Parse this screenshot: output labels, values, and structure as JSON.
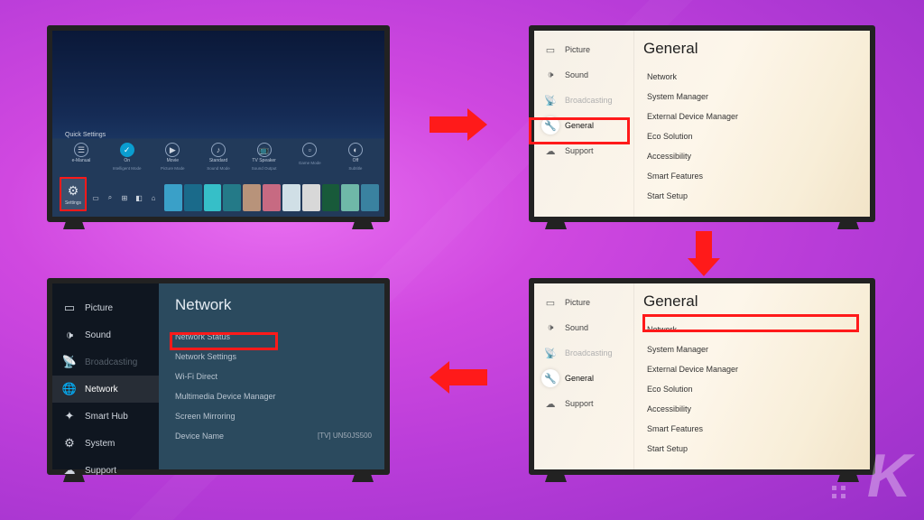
{
  "tv1": {
    "quickSettingsTitle": "Quick Settings",
    "items": [
      {
        "label": "e-Manual",
        "sub": ""
      },
      {
        "label": "On",
        "sub": "Intelligent Mode"
      },
      {
        "label": "Movie",
        "sub": "Picture Mode"
      },
      {
        "label": "Standard",
        "sub": "Sound Mode"
      },
      {
        "label": "TV Speaker",
        "sub": "Sound Output"
      },
      {
        "label": "",
        "sub": "Game Mode"
      },
      {
        "label": "Off",
        "sub": "Subtitle"
      }
    ],
    "settingsIcon": {
      "label": "Settings"
    },
    "tileColors": [
      "#3aa0c8",
      "#1a6a8a",
      "#36bfc8",
      "#247a88",
      "#b8937a",
      "#c76a82",
      "#d0dfe6",
      "#d8d8d8",
      "#185a3a",
      "#6fb8a8",
      "#3a82a0"
    ]
  },
  "lightPanel": {
    "sidebar": [
      {
        "icon": "picture-icon",
        "label": "Picture"
      },
      {
        "icon": "sound-icon",
        "label": "Sound"
      },
      {
        "icon": "broadcast-icon",
        "label": "Broadcasting",
        "dim": true
      },
      {
        "icon": "general-icon",
        "label": "General",
        "selected": true
      },
      {
        "icon": "support-icon",
        "label": "Support"
      }
    ],
    "title": "General",
    "items": [
      "Network",
      "System Manager",
      "External Device Manager",
      "Eco Solution",
      "Accessibility",
      "Smart Features",
      "Start Setup"
    ]
  },
  "darkPanel": {
    "sidebar": [
      {
        "icon": "picture-icon",
        "label": "Picture"
      },
      {
        "icon": "sound-icon",
        "label": "Sound"
      },
      {
        "icon": "broadcast-icon",
        "label": "Broadcasting",
        "dim": true
      },
      {
        "icon": "network-icon",
        "label": "Network",
        "selected": true
      },
      {
        "icon": "smarthub-icon",
        "label": "Smart Hub"
      },
      {
        "icon": "system-icon",
        "label": "System"
      },
      {
        "icon": "support-icon",
        "label": "Support"
      }
    ],
    "title": "Network",
    "items": [
      {
        "label": "Network Status"
      },
      {
        "label": "Network Settings",
        "highlight": true
      },
      {
        "label": "Wi-Fi Direct"
      },
      {
        "label": "Multimedia Device Manager"
      },
      {
        "label": "Screen Mirroring"
      },
      {
        "label": "Device Name",
        "value": "[TV] UN50JS500"
      }
    ]
  },
  "watermark": "K"
}
